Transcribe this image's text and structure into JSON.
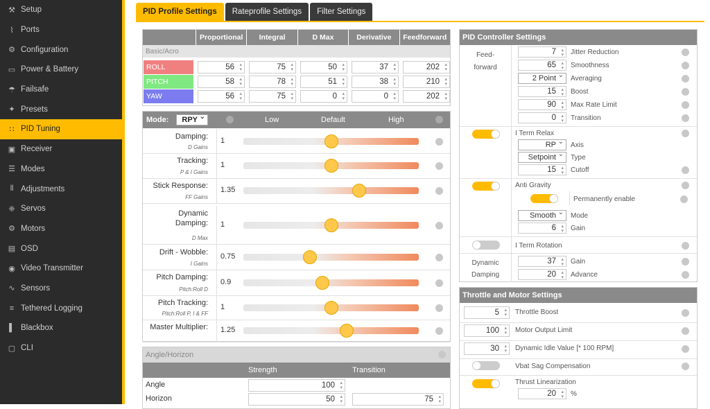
{
  "sidebar": {
    "items": [
      {
        "icon": "wrench-icon",
        "glyph": "⚒",
        "label": "Setup"
      },
      {
        "icon": "ports-icon",
        "glyph": "⌇",
        "label": "Ports"
      },
      {
        "icon": "gear-icon",
        "glyph": "⚙",
        "label": "Configuration"
      },
      {
        "icon": "battery-icon",
        "glyph": "▭",
        "label": "Power & Battery"
      },
      {
        "icon": "parachute-icon",
        "glyph": "☂",
        "label": "Failsafe"
      },
      {
        "icon": "presets-icon",
        "glyph": "✦",
        "label": "Presets"
      },
      {
        "icon": "pid-icon",
        "glyph": "∷",
        "label": "PID Tuning"
      },
      {
        "icon": "receiver-icon",
        "glyph": "▣",
        "label": "Receiver"
      },
      {
        "icon": "modes-icon",
        "glyph": "☰",
        "label": "Modes"
      },
      {
        "icon": "adjustments-icon",
        "glyph": "⫴",
        "label": "Adjustments"
      },
      {
        "icon": "servo-icon",
        "glyph": "❈",
        "label": "Servos"
      },
      {
        "icon": "motor-icon",
        "glyph": "⚙",
        "label": "Motors"
      },
      {
        "icon": "osd-icon",
        "glyph": "▤",
        "label": "OSD"
      },
      {
        "icon": "vtx-icon",
        "glyph": "◉",
        "label": "Video Transmitter"
      },
      {
        "icon": "sensors-icon",
        "glyph": "∿",
        "label": "Sensors"
      },
      {
        "icon": "logging-icon",
        "glyph": "≡",
        "label": "Tethered Logging"
      },
      {
        "icon": "blackbox-icon",
        "glyph": "▌",
        "label": "Blackbox"
      },
      {
        "icon": "cli-icon",
        "glyph": "▢",
        "label": "CLI"
      }
    ]
  },
  "tabs": [
    "PID Profile Settings",
    "Rateprofile Settings",
    "Filter Settings"
  ],
  "pid": {
    "headers": [
      "Proportional",
      "Integral",
      "D Max",
      "Derivative",
      "Feedforward"
    ],
    "group": "Basic/Acro",
    "rows": [
      {
        "axis": "ROLL",
        "color": "#f08080",
        "values": [
          "56",
          "75",
          "50",
          "37",
          "202"
        ]
      },
      {
        "axis": "PITCH",
        "color": "#80e880",
        "values": [
          "58",
          "78",
          "51",
          "38",
          "210"
        ]
      },
      {
        "axis": "YAW",
        "color": "#7c7cf0",
        "values": [
          "56",
          "75",
          "0",
          "0",
          "202"
        ]
      }
    ]
  },
  "sliders": {
    "mode_label": "Mode:",
    "mode_value": "RPY",
    "col_low": "Low",
    "col_default": "Default",
    "col_high": "High",
    "rows": [
      {
        "label": "Damping:",
        "sub": "D Gains",
        "value": "1",
        "pos": 0.5
      },
      {
        "label": "Tracking:",
        "sub": "P & I Gains",
        "value": "1",
        "pos": 0.5
      },
      {
        "label": "Stick Response:",
        "sub": "FF Gains",
        "value": "1.35",
        "pos": 0.66
      },
      {
        "label": "Dynamic\nDamping:",
        "sub": "D Max",
        "value": "1",
        "pos": 0.5
      },
      {
        "label": "Drift - Wobble:",
        "sub": "I Gains",
        "value": "0.75",
        "pos": 0.38
      },
      {
        "label": "Pitch Damping:",
        "sub": "Pitch:Roll D",
        "value": "0.9",
        "pos": 0.45
      },
      {
        "label": "Pitch Tracking:",
        "sub": "Pitch:Roll P, I & FF",
        "value": "1",
        "pos": 0.5
      },
      {
        "label": "Master Multiplier:",
        "sub": "",
        "value": "1.25",
        "pos": 0.59
      }
    ]
  },
  "angle": {
    "title": "Angle/Horizon",
    "col_strength": "Strength",
    "col_transition": "Transition",
    "rows": [
      {
        "label": "Angle",
        "strength": "100",
        "transition": ""
      },
      {
        "label": "Horizon",
        "strength": "50",
        "transition": "75"
      }
    ]
  },
  "controller": {
    "title": "PID Controller Settings",
    "feedforward_label": "Feed-\nforward",
    "ff_rows": [
      {
        "value": "7",
        "label": "Jitter Reduction"
      },
      {
        "value": "65",
        "label": "Smoothness"
      },
      {
        "value": "2 Point",
        "label": "Averaging",
        "select": true
      },
      {
        "value": "15",
        "label": "Boost"
      },
      {
        "value": "90",
        "label": "Max Rate Limit"
      },
      {
        "value": "0",
        "label": "Transition"
      }
    ],
    "iterm_relax": {
      "label": "I Term Relax",
      "axis_value": "RP",
      "axis_label": "Axis",
      "type_value": "Setpoint",
      "type_label": "Type",
      "cutoff_value": "15",
      "cutoff_label": "Cutoff"
    },
    "anti_gravity": {
      "label": "Anti Gravity",
      "perm_label": "Permanently enable",
      "mode_value": "Smooth",
      "mode_label": "Mode",
      "gain_value": "6",
      "gain_label": "Gain"
    },
    "iterm_rotation": {
      "label": "I Term Rotation"
    },
    "dyn_damping": {
      "label": "Dynamic\nDamping",
      "gain_value": "37",
      "gain_label": "Gain",
      "advance_value": "20",
      "advance_label": "Advance"
    }
  },
  "throttle": {
    "title": "Throttle and Motor Settings",
    "rows": [
      {
        "value": "5",
        "label": "Throttle Boost"
      },
      {
        "value": "100",
        "label": "Motor Output Limit"
      },
      {
        "value": "30",
        "label": "Dynamic Idle Value [* 100 RPM]"
      }
    ],
    "vbat_label": "Vbat Sag Compensation",
    "thrust_label": "Thrust Linearization",
    "thrust_value": "20",
    "thrust_unit": "%"
  },
  "colors": {
    "accent": "#ffbb00",
    "sidebar": "#2b2b2b"
  }
}
